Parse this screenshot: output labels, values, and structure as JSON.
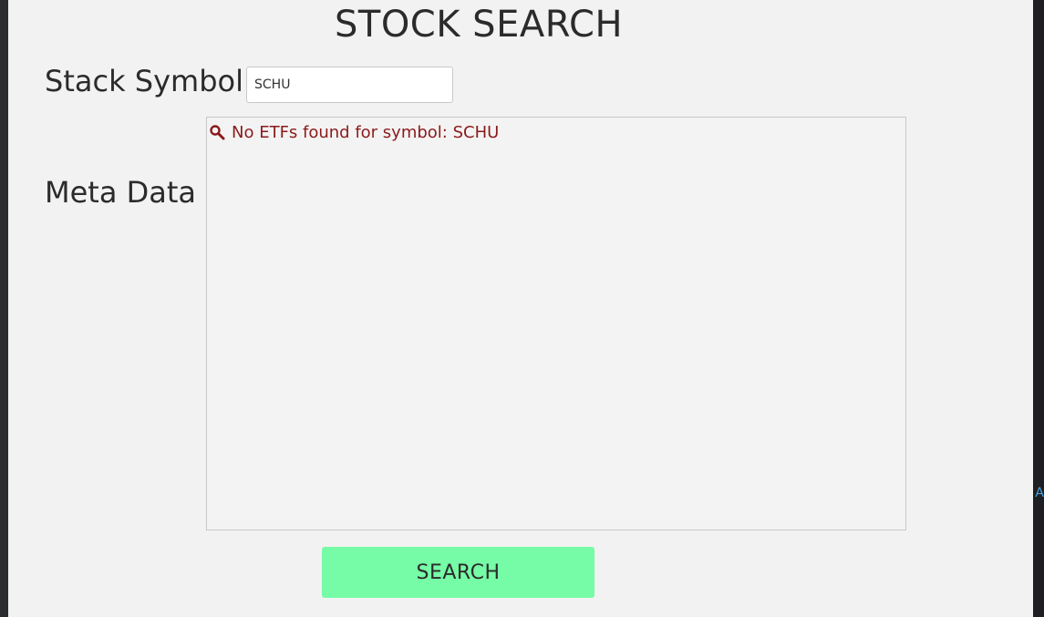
{
  "page": {
    "title": "STOCK SEARCH"
  },
  "form": {
    "symbol_label": "Stack Symbol",
    "symbol_value": "SCHU",
    "meta_label": "Meta Data",
    "meta_message": "No ETFs found for symbol: SCHU",
    "meta_message_icon": "search-icon",
    "search_button_label": "SEARCH"
  },
  "colors": {
    "button_bg": "#76fba6",
    "message_text": "#8b1a1a",
    "panel_bg": "#f2f2f2"
  }
}
